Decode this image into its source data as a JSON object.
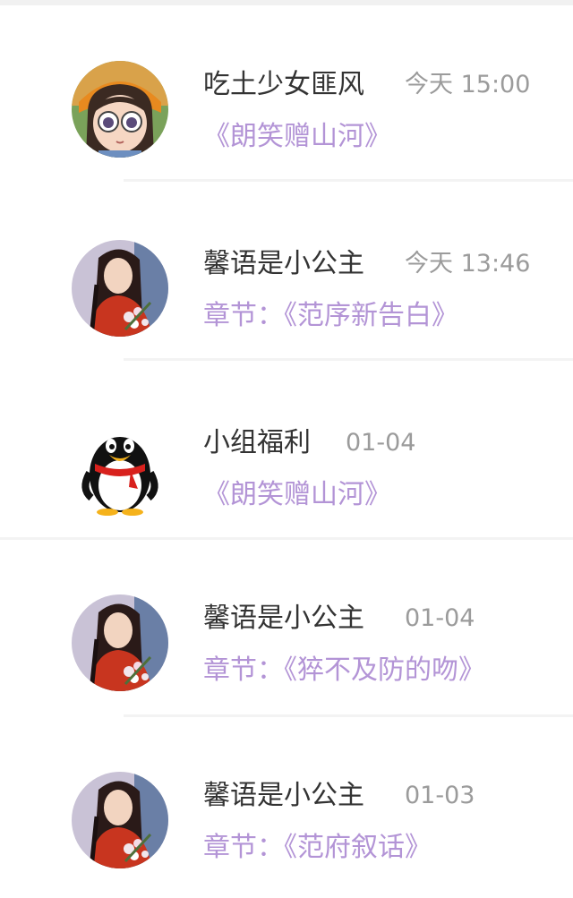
{
  "messages": [
    {
      "avatar": "anime-girl-avatar",
      "name": "吃土少女匪风",
      "time": "今天 15:00",
      "subtitle": "《朗笑赠山河》"
    },
    {
      "avatar": "portrait-woman-avatar",
      "name": "馨语是小公主",
      "time": "今天 13:46",
      "subtitle": "章节：《范序新告白》"
    },
    {
      "avatar": "qq-penguin-avatar",
      "name": "小组福利",
      "time": "01-04",
      "subtitle": "《朗笑赠山河》"
    },
    {
      "avatar": "portrait-woman-avatar",
      "name": "馨语是小公主",
      "time": "01-04",
      "subtitle": "章节：《猝不及防的吻》"
    },
    {
      "avatar": "portrait-woman-avatar",
      "name": "馨语是小公主",
      "time": "01-03",
      "subtitle": "章节：《范府叙话》"
    }
  ],
  "colors": {
    "name": "#333333",
    "time": "#9b9b9b",
    "subtitle": "#b394d6",
    "divider": "#f3f3f3"
  }
}
